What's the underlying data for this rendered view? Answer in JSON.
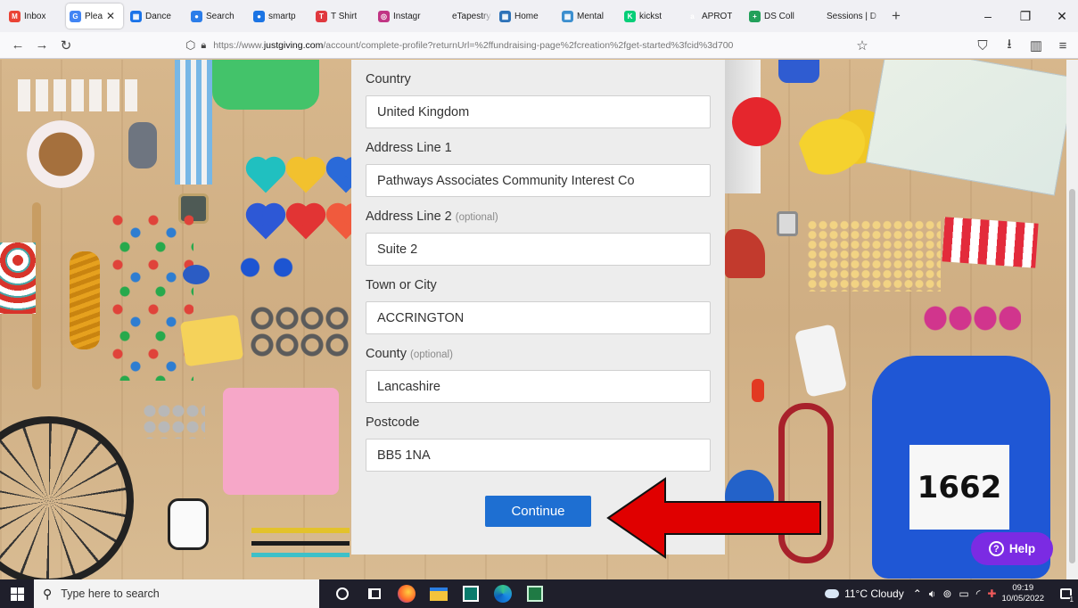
{
  "browser": {
    "tabs": [
      {
        "label": "Inbox",
        "favicon": "gmail-icon",
        "color": "#ea4335",
        "glyph": "M",
        "width": 64
      },
      {
        "label": "Plea",
        "favicon": "google-icon",
        "color": "#4285f4",
        "glyph": "G",
        "width": 64,
        "active": true,
        "close": "✕"
      },
      {
        "label": "Dance",
        "favicon": "calendar-icon",
        "color": "#1a73e8",
        "glyph": "▦",
        "width": 64
      },
      {
        "label": "Search",
        "favicon": "search-site-icon",
        "color": "#2b7de9",
        "glyph": "●",
        "width": 66
      },
      {
        "label": "smartp",
        "favicon": "smartphone-site-icon",
        "color": "#1b74e4",
        "glyph": "●",
        "width": 66
      },
      {
        "label": "T Shirt",
        "favicon": "tshirt-site-icon",
        "color": "#e0383e",
        "glyph": "T",
        "width": 66
      },
      {
        "label": "Instagr",
        "favicon": "instagram-icon",
        "color": "#c13584",
        "glyph": "◎",
        "width": 62
      },
      {
        "label": "eTapestry -",
        "favicon": "etapestry-icon",
        "color": "#f0f0f4",
        "glyph": "",
        "width": 66
      },
      {
        "label": "Home",
        "favicon": "home-site-icon",
        "color": "#2d72b8",
        "glyph": "▦",
        "width": 66
      },
      {
        "label": "Mental",
        "favicon": "mental-site-icon",
        "color": "#3c8fcf",
        "glyph": "▦",
        "width": 66
      },
      {
        "label": "kickst",
        "favicon": "kickstarter-icon",
        "color": "#05ce78",
        "glyph": "K",
        "width": 66
      },
      {
        "label": "APROT",
        "favicon": "amazon-icon",
        "color": "#f0f0f4",
        "glyph": "a",
        "width": 66
      },
      {
        "label": "DS Coll",
        "favicon": "ds-site-icon",
        "color": "#22a05a",
        "glyph": "+",
        "width": 66
      },
      {
        "label": "Sessions | D",
        "favicon": "sessions-site-icon",
        "color": "#f0f0f4",
        "glyph": "",
        "width": 82
      }
    ],
    "new_tab": "+",
    "window": {
      "minimize": "–",
      "restore": "❐",
      "close": "✕"
    },
    "nav": {
      "back": "←",
      "forward": "→",
      "reload": "↻",
      "lock": "🔒︎",
      "shield": "⬡"
    },
    "url_prefix": "https://www.",
    "url_host": "justgiving.com",
    "url_path": "/account/complete-profile?returnUrl=%2ffundraising-page%2fcreation%2fget-started%3fcid%3d700",
    "bookmark_star": "☆",
    "right_icons": {
      "pocket": "⛉",
      "download": "⭳",
      "sidebar": "▥",
      "menu": "≡"
    }
  },
  "form": {
    "fields": [
      {
        "name": "country",
        "label": "Country",
        "optional": "",
        "value": "United Kingdom"
      },
      {
        "name": "address-line-1",
        "label": "Address Line 1",
        "optional": "",
        "value": "Pathways Associates Community Interest Co"
      },
      {
        "name": "address-line-2",
        "label": "Address Line 2",
        "optional": "(optional)",
        "value": "Suite 2"
      },
      {
        "name": "town-or-city",
        "label": "Town or City",
        "optional": "",
        "value": "ACCRINGTON"
      },
      {
        "name": "county",
        "label": "County",
        "optional": "(optional)",
        "value": "Lancashire"
      },
      {
        "name": "postcode",
        "label": "Postcode",
        "optional": "",
        "value": "BB5 1NA"
      }
    ],
    "continue_label": "Continue"
  },
  "background": {
    "vest_number": "1662"
  },
  "help": {
    "label": "Help",
    "glyph": "?"
  },
  "colors": {
    "primary_button": "#1e6fd2",
    "help_button": "#7b2be3",
    "annotation_arrow": "#e00000"
  },
  "taskbar": {
    "search_placeholder": "Type here to search",
    "weather": "11°C  Cloudy",
    "time": "09:19",
    "date": "10/05/2022",
    "notification_count": "1"
  }
}
